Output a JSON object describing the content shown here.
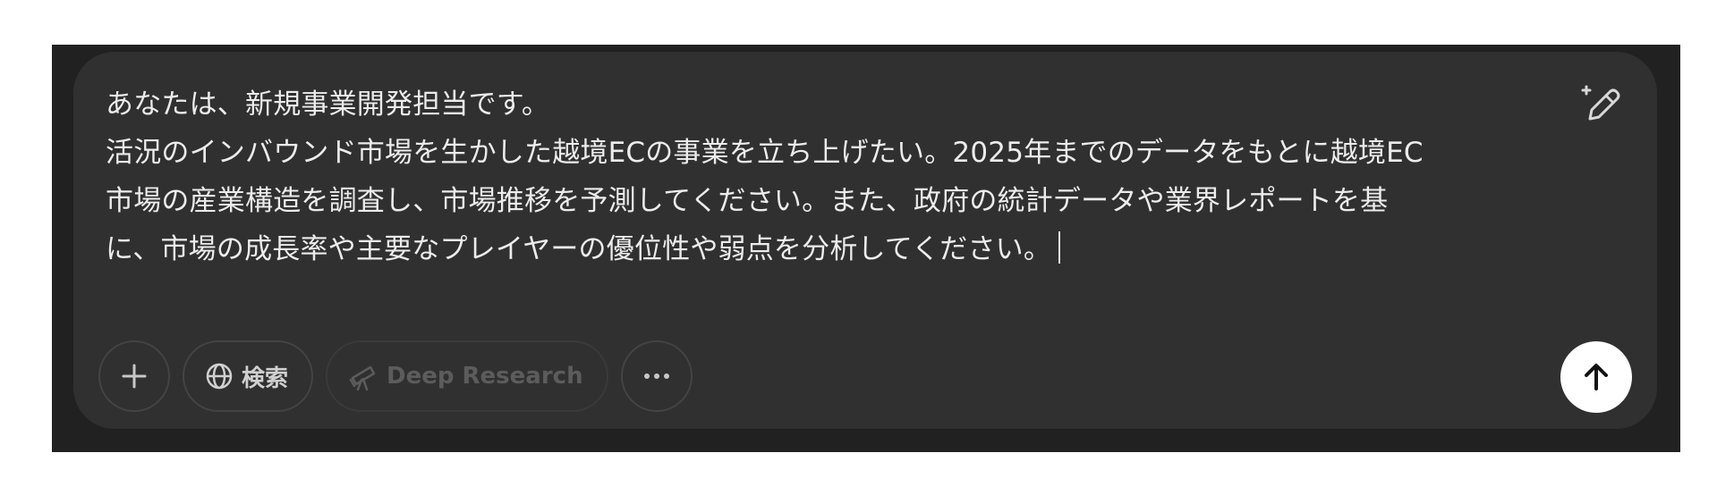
{
  "composer": {
    "text_lines": [
      "あなたは、新規事業開発担当です。",
      "活況のインバウンド市場を生かした越境ECの事業を立ち上げたい。2025年までのデータをもとに越境EC",
      "市場の産業構造を調査し、市場推移を予測してください。また、政府の統計データや業界レポートを基",
      "に、市場の成長率や主要なプレイヤーの優位性や弱点を分析してください。"
    ]
  },
  "toolbar": {
    "add_icon": "plus-icon",
    "search_label": "検索",
    "search_icon": "globe-icon",
    "deep_research_label": "Deep Research",
    "deep_research_icon": "telescope-icon",
    "more_icon": "ellipsis-icon"
  },
  "send_icon": "arrow-up-icon",
  "edit_icon": "sparkle-pen-icon",
  "colors": {
    "panel_background": "#212121",
    "composer_background": "#303030",
    "text": "#ececec",
    "send_button": "#ffffff"
  }
}
